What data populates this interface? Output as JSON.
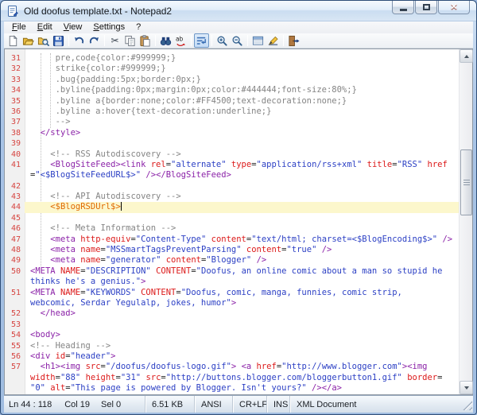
{
  "window": {
    "title": "Old doofus template.txt - Notepad2"
  },
  "menu_bar": {
    "items": [
      "File",
      "Edit",
      "View",
      "Settings",
      "?"
    ]
  },
  "toolbar": {
    "buttons": [
      {
        "name": "new-file-button",
        "icon": "new"
      },
      {
        "name": "open-file-button",
        "icon": "open"
      },
      {
        "name": "browse-files-button",
        "icon": "browse"
      },
      {
        "name": "save-button",
        "icon": "save"
      },
      {
        "sep": true
      },
      {
        "name": "undo-button",
        "icon": "undo"
      },
      {
        "name": "redo-button",
        "icon": "redo"
      },
      {
        "sep": true
      },
      {
        "name": "cut-button",
        "icon": "cut"
      },
      {
        "name": "copy-button",
        "icon": "copy"
      },
      {
        "name": "paste-button",
        "icon": "paste"
      },
      {
        "sep": true
      },
      {
        "name": "find-button",
        "icon": "find"
      },
      {
        "name": "replace-button",
        "icon": "replace"
      },
      {
        "sep": true
      },
      {
        "name": "word-wrap-button",
        "icon": "wrap",
        "pressed": true
      },
      {
        "sep": true
      },
      {
        "name": "zoom-in-button",
        "icon": "zoomin"
      },
      {
        "name": "zoom-out-button",
        "icon": "zoomout"
      },
      {
        "sep": true
      },
      {
        "name": "customize-schemes-button",
        "icon": "schemes"
      },
      {
        "name": "select-scheme-button",
        "icon": "scheme"
      },
      {
        "sep": true
      },
      {
        "name": "exit-button",
        "icon": "exit"
      }
    ]
  },
  "editor": {
    "colors": {
      "t": "#8B22A8",
      "a": "#DC1A1A",
      "s": "#2B3FC4",
      "c": "#848484",
      "p": "#202020",
      "o": "#E06800",
      "line_number": "#D64541",
      "current_line_bg": "#FCF7CC"
    },
    "rows": [
      {
        "num": "31",
        "ind": 5,
        "segs": [
          [
            "c",
            "pre,code{color:#999999;}"
          ]
        ]
      },
      {
        "num": "32",
        "ind": 5,
        "segs": [
          [
            "c",
            "strike{color:#999999;}"
          ]
        ]
      },
      {
        "num": "33",
        "ind": 5,
        "segs": [
          [
            "c",
            ".bug{padding:5px;border:0px;}"
          ]
        ]
      },
      {
        "num": "34",
        "ind": 5,
        "segs": [
          [
            "c",
            ".byline{padding:0px;margin:0px;color:#444444;font-size:80%;}"
          ]
        ]
      },
      {
        "num": "35",
        "ind": 5,
        "segs": [
          [
            "c",
            ".byline a{border:none;color:#FF4500;text-decoration:none;}"
          ]
        ]
      },
      {
        "num": "36",
        "ind": 5,
        "segs": [
          [
            "c",
            ".byline a:hover{text-decoration:underline;}"
          ]
        ]
      },
      {
        "num": "37",
        "ind": 5,
        "segs": [
          [
            "c",
            "-->"
          ]
        ]
      },
      {
        "num": "38",
        "ind": 2,
        "segs": [
          [
            "t",
            "</style>"
          ]
        ]
      },
      {
        "num": "39",
        "ind": 0,
        "segs": []
      },
      {
        "num": "40",
        "ind": 4,
        "segs": [
          [
            "c",
            "<!-- RSS Autodiscovery -->"
          ]
        ]
      },
      {
        "num": "41",
        "ind": 4,
        "segs": [
          [
            "t",
            "<BlogSiteFeed><link "
          ],
          [
            "a",
            "rel"
          ],
          [
            "p",
            "="
          ],
          [
            "s",
            "\"alternate\""
          ],
          [
            "p",
            " "
          ],
          [
            "a",
            "type"
          ],
          [
            "p",
            "="
          ],
          [
            "s",
            "\"application/rss+xml\""
          ],
          [
            "p",
            " "
          ],
          [
            "a",
            "title"
          ],
          [
            "p",
            "="
          ],
          [
            "s",
            "\"RSS\""
          ],
          [
            "p",
            " "
          ],
          [
            "a",
            "href"
          ]
        ]
      },
      {
        "num": "",
        "ind": 0,
        "segs": [
          [
            "p",
            "="
          ],
          [
            "s",
            "\"<$BlogSiteFeedURL$>\""
          ],
          [
            "p",
            " "
          ],
          [
            "t",
            "/></BlogSiteFeed>"
          ]
        ]
      },
      {
        "num": "42",
        "ind": 0,
        "segs": []
      },
      {
        "num": "43",
        "ind": 4,
        "segs": [
          [
            "c",
            "<!-- API Autodiscovery -->"
          ]
        ]
      },
      {
        "num": "44",
        "ind": 4,
        "highlight": true,
        "caret": true,
        "segs": [
          [
            "o",
            "<$BlogRSDUrl$>"
          ]
        ]
      },
      {
        "num": "45",
        "ind": 0,
        "segs": []
      },
      {
        "num": "46",
        "ind": 4,
        "segs": [
          [
            "c",
            "<!-- Meta Information -->"
          ]
        ]
      },
      {
        "num": "47",
        "ind": 4,
        "segs": [
          [
            "t",
            "<meta "
          ],
          [
            "a",
            "http-equiv"
          ],
          [
            "p",
            "="
          ],
          [
            "s",
            "\"Content-Type\""
          ],
          [
            "p",
            " "
          ],
          [
            "a",
            "content"
          ],
          [
            "p",
            "="
          ],
          [
            "s",
            "\"text/html; charset=<$BlogEncoding$>\""
          ],
          [
            "p",
            " "
          ],
          [
            "t",
            "/>"
          ]
        ]
      },
      {
        "num": "48",
        "ind": 4,
        "segs": [
          [
            "t",
            "<meta "
          ],
          [
            "a",
            "name"
          ],
          [
            "p",
            "="
          ],
          [
            "s",
            "\"MSSmartTagsPreventParsing\""
          ],
          [
            "p",
            " "
          ],
          [
            "a",
            "content"
          ],
          [
            "p",
            "="
          ],
          [
            "s",
            "\"true\""
          ],
          [
            "p",
            " "
          ],
          [
            "t",
            "/>"
          ]
        ]
      },
      {
        "num": "49",
        "ind": 4,
        "segs": [
          [
            "t",
            "<meta "
          ],
          [
            "a",
            "name"
          ],
          [
            "p",
            "="
          ],
          [
            "s",
            "\"generator\""
          ],
          [
            "p",
            " "
          ],
          [
            "a",
            "content"
          ],
          [
            "p",
            "="
          ],
          [
            "s",
            "\"Blogger\""
          ],
          [
            "p",
            " "
          ],
          [
            "t",
            "/>"
          ]
        ]
      },
      {
        "num": "50",
        "ind": 0,
        "segs": [
          [
            "t",
            "<META "
          ],
          [
            "a",
            "NAME"
          ],
          [
            "p",
            "="
          ],
          [
            "s",
            "\"DESCRIPTION\""
          ],
          [
            "p",
            " "
          ],
          [
            "a",
            "CONTENT"
          ],
          [
            "p",
            "="
          ],
          [
            "s",
            "\"Doofus, an online comic about a man so stupid he"
          ]
        ]
      },
      {
        "num": "",
        "ind": 0,
        "segs": [
          [
            "s",
            "thinks he's a genius.\""
          ],
          [
            "t",
            ">"
          ]
        ]
      },
      {
        "num": "51",
        "ind": 0,
        "segs": [
          [
            "t",
            "<META "
          ],
          [
            "a",
            "NAME"
          ],
          [
            "p",
            "="
          ],
          [
            "s",
            "\"KEYWORDS\""
          ],
          [
            "p",
            " "
          ],
          [
            "a",
            "CONTENT"
          ],
          [
            "p",
            "="
          ],
          [
            "s",
            "\"Doofus, comic, manga, funnies, comic strip,"
          ]
        ]
      },
      {
        "num": "",
        "ind": 0,
        "segs": [
          [
            "s",
            "webcomic, Serdar Yegulalp, jokes, humor\""
          ],
          [
            "t",
            ">"
          ]
        ]
      },
      {
        "num": "52",
        "ind": 2,
        "segs": [
          [
            "t",
            "</head>"
          ]
        ]
      },
      {
        "num": "53",
        "ind": 0,
        "segs": []
      },
      {
        "num": "54",
        "ind": 0,
        "segs": [
          [
            "t",
            "<body>"
          ]
        ]
      },
      {
        "num": "55",
        "ind": 0,
        "segs": [
          [
            "c",
            "<!-- Heading -->"
          ]
        ]
      },
      {
        "num": "56",
        "ind": 0,
        "segs": [
          [
            "t",
            "<div "
          ],
          [
            "a",
            "id"
          ],
          [
            "p",
            "="
          ],
          [
            "s",
            "\"header\""
          ],
          [
            "t",
            ">"
          ]
        ]
      },
      {
        "num": "57",
        "ind": 2,
        "segs": [
          [
            "t",
            "<h1><img "
          ],
          [
            "a",
            "src"
          ],
          [
            "p",
            "="
          ],
          [
            "s",
            "\"/doofus/doofus-logo.gif\""
          ],
          [
            "t",
            ">"
          ],
          [
            "p",
            " "
          ],
          [
            "t",
            "<a "
          ],
          [
            "a",
            "href"
          ],
          [
            "p",
            "="
          ],
          [
            "s",
            "\"http://www.blogger.com\""
          ],
          [
            "t",
            "><img"
          ]
        ]
      },
      {
        "num": "",
        "ind": 0,
        "segs": [
          [
            "a",
            "width"
          ],
          [
            "p",
            "="
          ],
          [
            "s",
            "\"88\""
          ],
          [
            "p",
            " "
          ],
          [
            "a",
            "height"
          ],
          [
            "p",
            "="
          ],
          [
            "s",
            "\"31\""
          ],
          [
            "p",
            " "
          ],
          [
            "a",
            "src"
          ],
          [
            "p",
            "="
          ],
          [
            "s",
            "\"http://buttons.blogger.com/bloggerbutton1.gif\""
          ],
          [
            "p",
            " "
          ],
          [
            "a",
            "border"
          ],
          [
            "p",
            "="
          ]
        ]
      },
      {
        "num": "",
        "ind": 0,
        "segs": [
          [
            "s",
            "\"0\""
          ],
          [
            "p",
            " "
          ],
          [
            "a",
            "alt"
          ],
          [
            "p",
            "="
          ],
          [
            "s",
            "\"This page is powered by Blogger. Isn't yours?\""
          ],
          [
            "p",
            " "
          ],
          [
            "t",
            "/></a>"
          ]
        ]
      }
    ]
  },
  "status_bar": {
    "line": "Ln 44 : 118",
    "column": "Col 19",
    "selection": "Sel 0",
    "size": "6.51 KB",
    "encoding": "ANSI",
    "eol": "CR+LF",
    "mode": "INS",
    "doc_type": "XML Document"
  }
}
